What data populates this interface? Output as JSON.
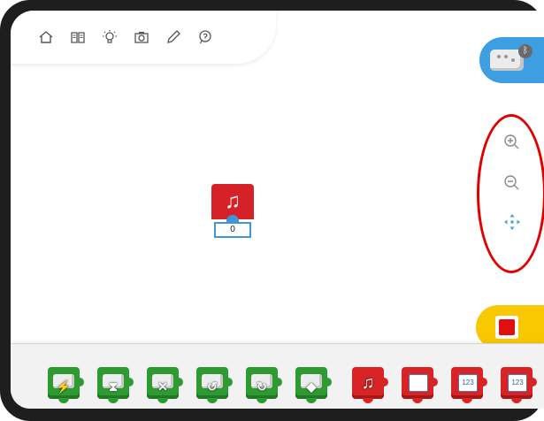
{
  "toolbar": {
    "icons": [
      "home-icon",
      "book-icon",
      "lightbulb-icon",
      "camera-icon",
      "pencil-icon",
      "help-icon"
    ]
  },
  "canvas": {
    "block": {
      "icon": "music-note-icon",
      "symbol": "♫",
      "value": "0"
    }
  },
  "hub": {
    "bluetooth_symbol": "ᛒ"
  },
  "zoom": {
    "zoom_in": "zoom-in-icon",
    "zoom_out": "zoom-out-icon",
    "fit": "fit-to-screen-icon"
  },
  "stop_button": {
    "color": "#f8c800",
    "stop_color": "#e01010"
  },
  "palette": {
    "blocks": [
      {
        "name": "motor-power-block",
        "color": "green",
        "symbol": "⚡"
      },
      {
        "name": "motor-time-block",
        "color": "green",
        "symbol": "⧗"
      },
      {
        "name": "motor-stop-block",
        "color": "green",
        "symbol": "✕"
      },
      {
        "name": "motor-counterclockwise-block",
        "color": "green",
        "symbol": "↺"
      },
      {
        "name": "motor-clockwise-block",
        "color": "green",
        "symbol": "↻"
      },
      {
        "name": "light-block",
        "color": "green",
        "symbol": "◆"
      },
      {
        "name": "sound-block",
        "color": "red",
        "symbol": "♫"
      },
      {
        "name": "background-block",
        "color": "red",
        "symbol": "▭"
      },
      {
        "name": "display-number-block",
        "color": "red",
        "symbol": "123"
      },
      {
        "name": "add-to-display-block",
        "color": "red",
        "symbol": "123"
      }
    ]
  },
  "colors": {
    "accent_blue": "#3d9ee2",
    "highlight": "#e00000"
  }
}
